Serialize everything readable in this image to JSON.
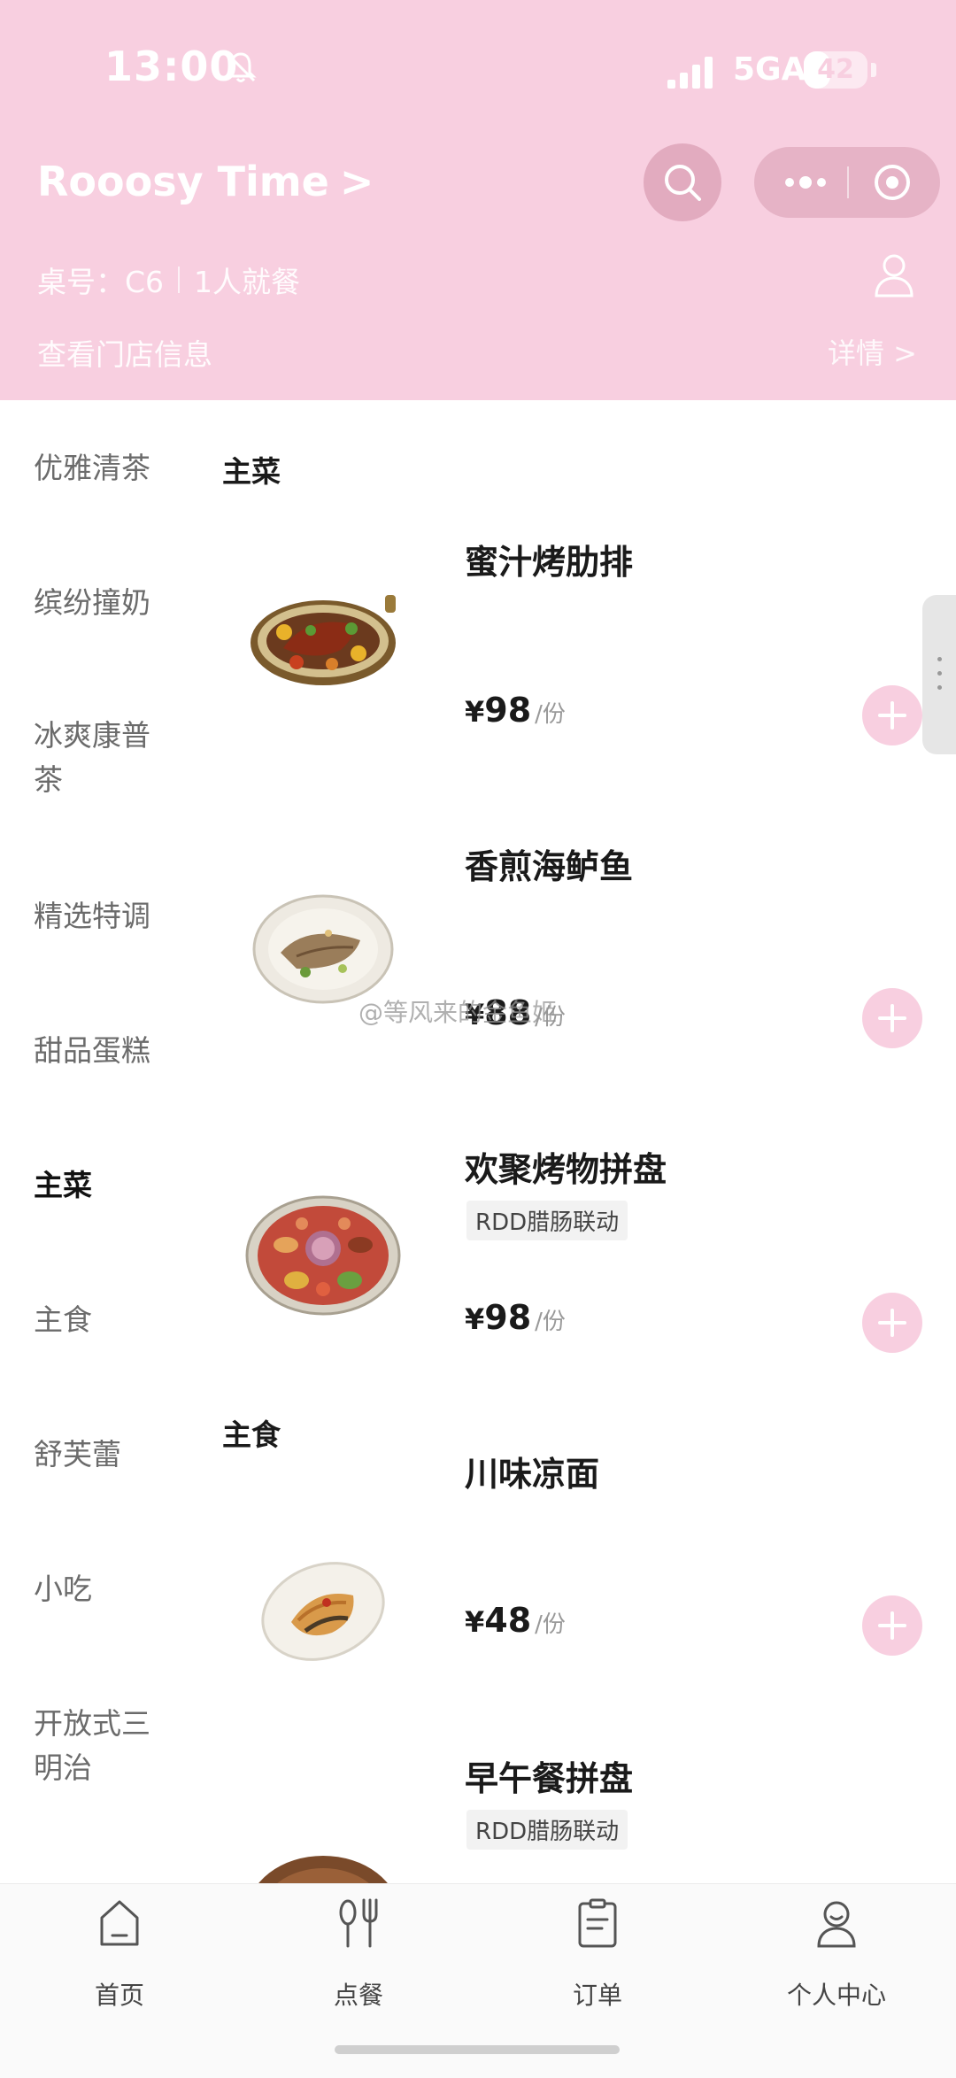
{
  "status_bar": {
    "time": "13:00",
    "network": "5GA",
    "battery": "42",
    "battery_level": 0.42,
    "icons": [
      "bell-muted-icon",
      "signal-icon"
    ]
  },
  "header": {
    "store_name": "Rooosy Time",
    "store_chevron": ">",
    "table_label": "桌号：C6",
    "party_size": "1人就餐",
    "store_info": "查看门店信息",
    "details": "详情 >",
    "colors": {
      "header_bg": "#f8cfe0",
      "capsule_bg": "#e6b3c6",
      "search_bg": "#e2abbf"
    }
  },
  "categories": [
    {
      "label": "优雅清茶",
      "active": false
    },
    {
      "label": "缤纷撞奶",
      "active": false
    },
    {
      "label": "冰爽康普茶",
      "active": false
    },
    {
      "label": "精选特调",
      "active": false
    },
    {
      "label": "甜品蛋糕",
      "active": false
    },
    {
      "label": "主菜",
      "active": true
    },
    {
      "label": "主食",
      "active": false
    },
    {
      "label": "舒芙蕾",
      "active": false
    },
    {
      "label": "小吃",
      "active": false
    },
    {
      "label": "开放式三明治",
      "active": false
    }
  ],
  "sections": [
    {
      "title": "主菜",
      "items": [
        {
          "name": "蜜汁烤肋排",
          "price": "98",
          "unit": "/份",
          "tag": ""
        },
        {
          "name": "香煎海鲈鱼",
          "price": "88",
          "unit": "/份",
          "tag": ""
        },
        {
          "name": "欢聚烤物拼盘",
          "price": "98",
          "unit": "/份",
          "tag": "RDD腊肠联动"
        }
      ]
    },
    {
      "title": "主食",
      "items": [
        {
          "name": "川味凉面",
          "price": "48",
          "unit": "/份",
          "tag": ""
        },
        {
          "name": "早午餐拼盘",
          "price": "",
          "unit": "",
          "tag": "RDD腊肠联动"
        }
      ]
    }
  ],
  "currency": "¥",
  "watermark": "@等风来的金鱼姬",
  "bottom_nav": [
    {
      "label": "首页",
      "icon": "home-icon"
    },
    {
      "label": "点餐",
      "icon": "utensils-icon"
    },
    {
      "label": "订单",
      "icon": "clipboard-icon"
    },
    {
      "label": "个人中心",
      "icon": "person-icon"
    }
  ]
}
